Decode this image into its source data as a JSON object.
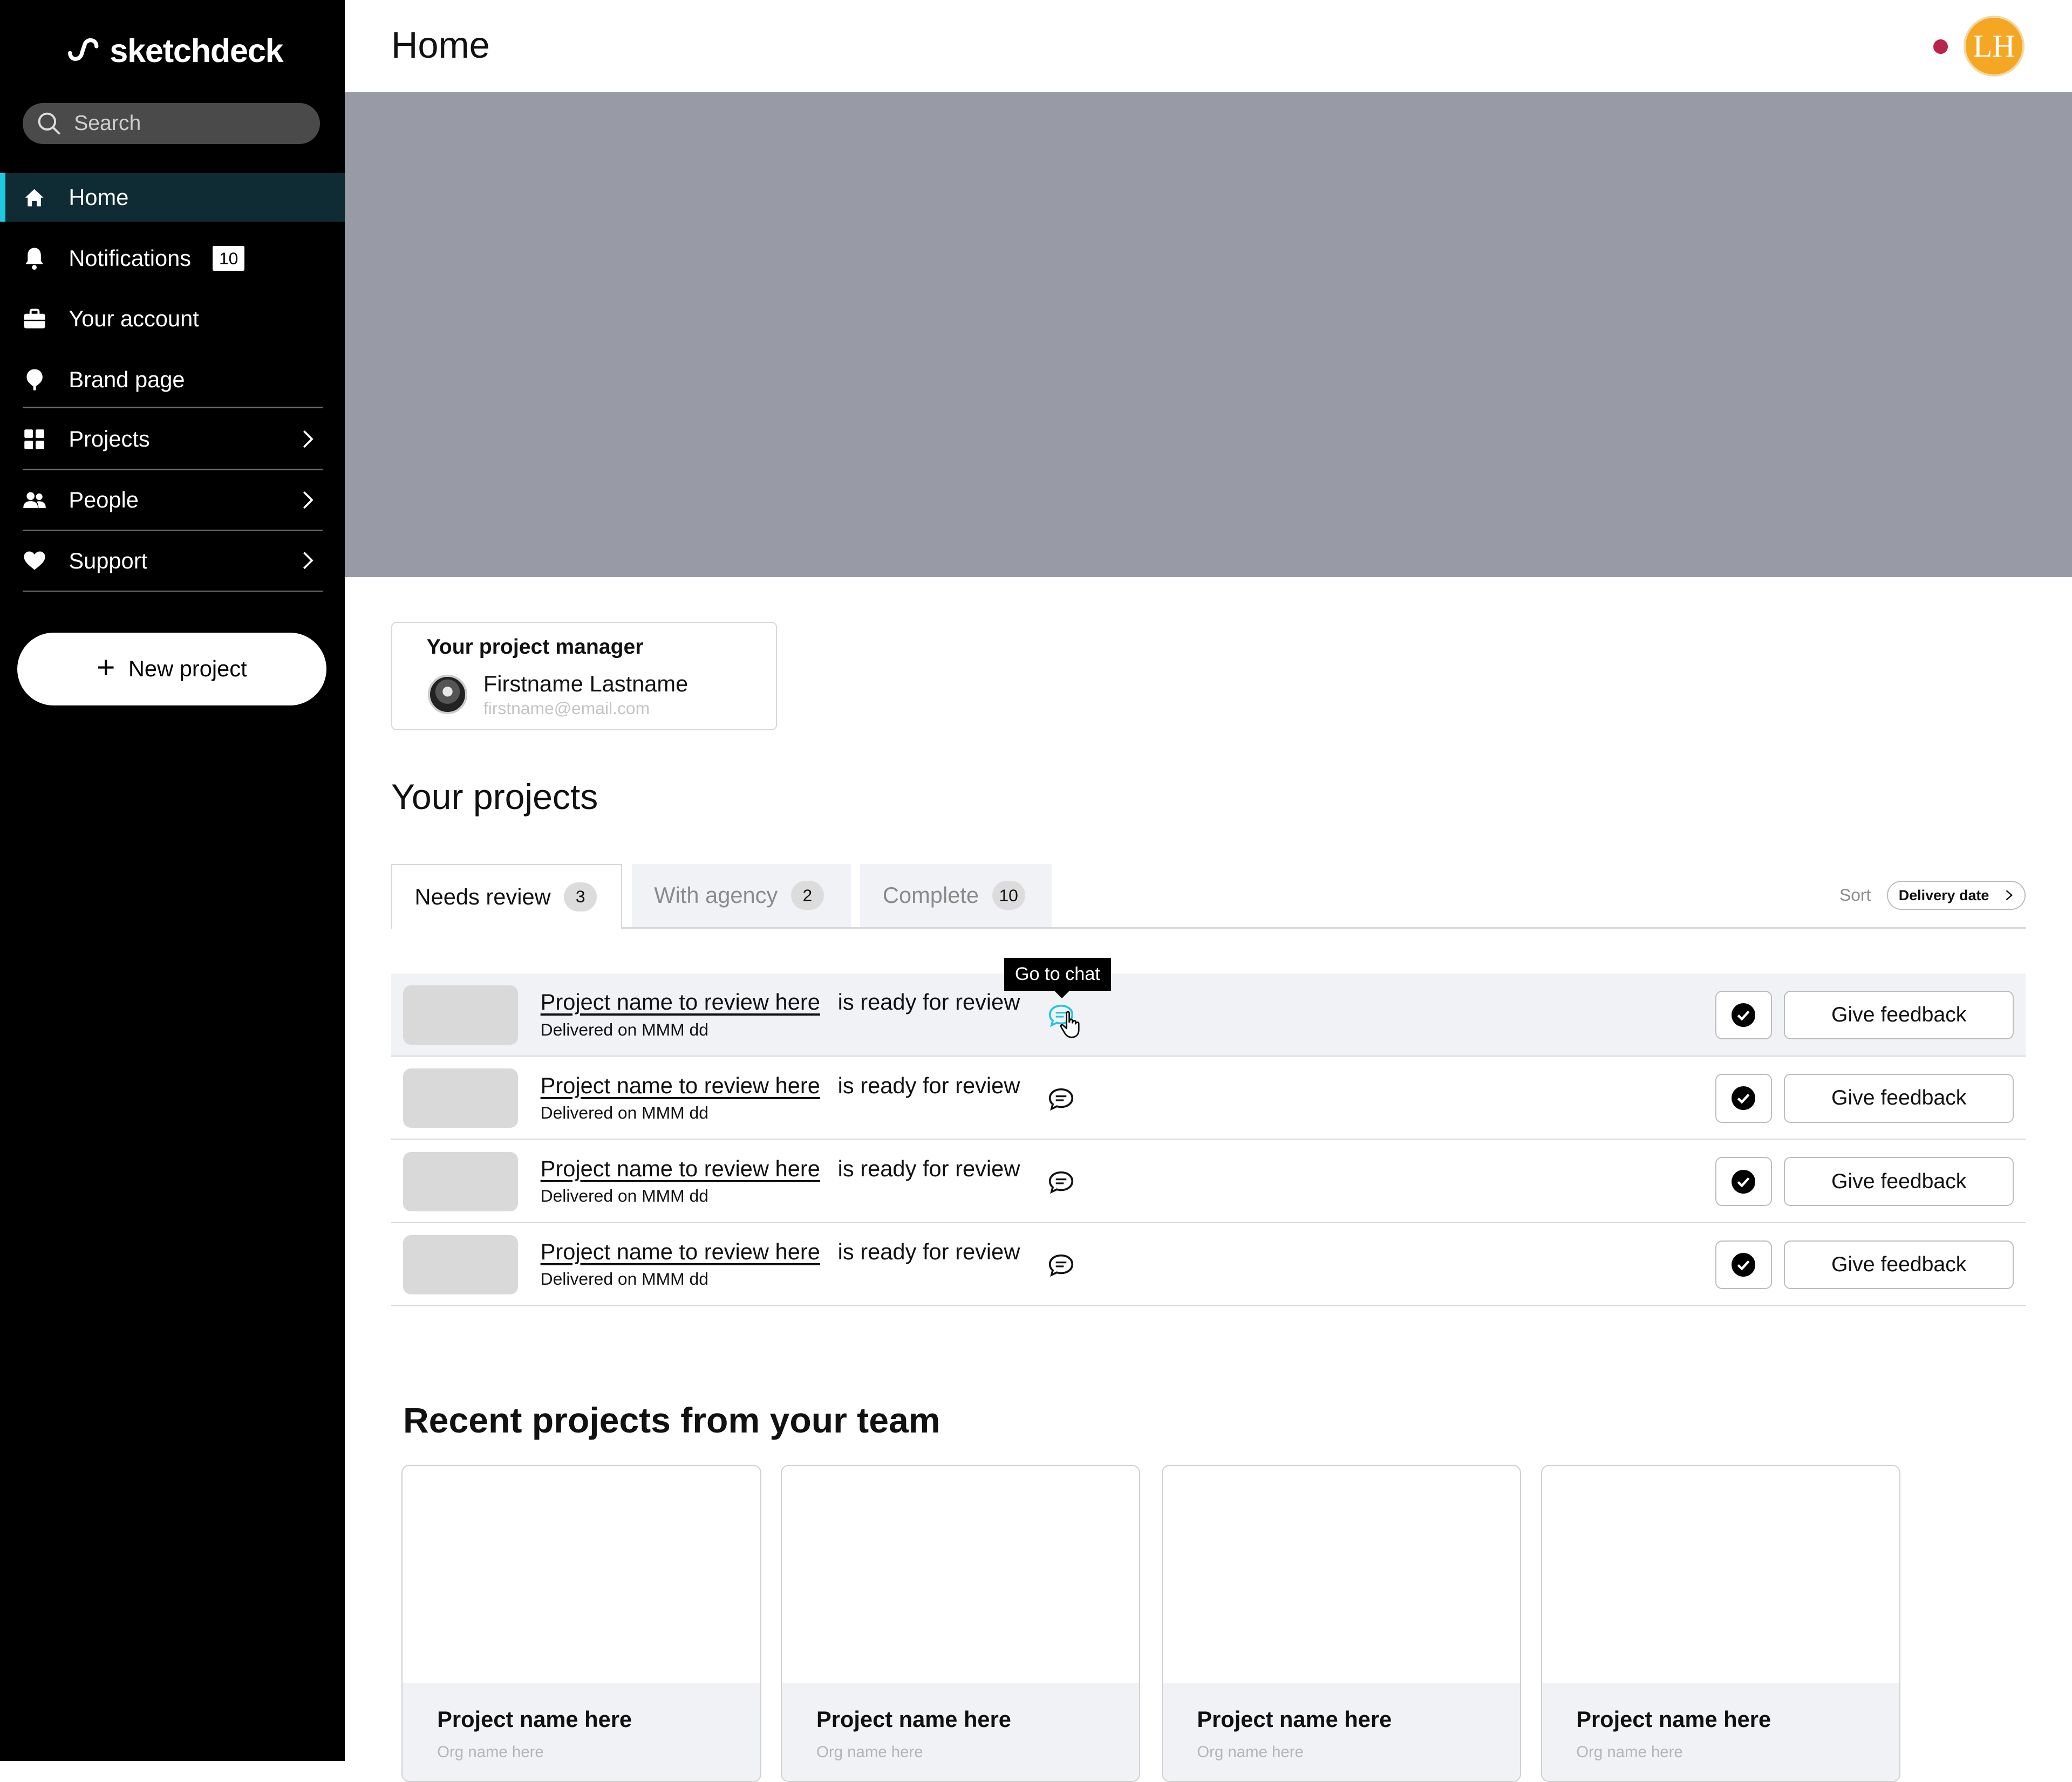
{
  "app": {
    "brand": "sketchdeck"
  },
  "search": {
    "placeholder": "Search"
  },
  "sidebar": {
    "items": [
      {
        "label": "Home",
        "icon": "home-icon",
        "active": true
      },
      {
        "label": "Notifications",
        "icon": "bell-icon",
        "badge": "10"
      },
      {
        "label": "Your account",
        "icon": "briefcase-icon"
      },
      {
        "label": "Brand page",
        "icon": "pin-icon"
      },
      {
        "label": "Projects",
        "icon": "grid-icon",
        "expandable": true
      },
      {
        "label": "People",
        "icon": "people-icon",
        "expandable": true
      },
      {
        "label": "Support",
        "icon": "heart-icon",
        "expandable": true
      }
    ],
    "new_project_label": "New project"
  },
  "header": {
    "title": "Home",
    "avatar_initials": "LH",
    "status_color": "#b8244a",
    "avatar_color": "#f5a623"
  },
  "project_manager": {
    "title": "Your project manager",
    "name": "Firstname Lastname",
    "email": "firstname@email.com"
  },
  "projects": {
    "heading": "Your projects",
    "tabs": [
      {
        "label": "Needs review",
        "count": "3",
        "active": true
      },
      {
        "label": "With agency",
        "count": "2"
      },
      {
        "label": "Complete",
        "count": "10"
      }
    ],
    "sort": {
      "label": "Sort",
      "value": "Delivery date"
    },
    "tooltip": "Go to chat",
    "rows": [
      {
        "name": "Project name to review here",
        "status": "is ready for review",
        "delivered": "Delivered on MMM dd",
        "feedback_label": "Give feedback"
      },
      {
        "name": "Project name to review here",
        "status": "is ready for review",
        "delivered": "Delivered on MMM dd",
        "feedback_label": "Give feedback"
      },
      {
        "name": "Project name to review here",
        "status": "is ready for review",
        "delivered": "Delivered on MMM dd",
        "feedback_label": "Give feedback"
      },
      {
        "name": "Project name to review here",
        "status": "is ready for review",
        "delivered": "Delivered on MMM dd",
        "feedback_label": "Give feedback"
      }
    ]
  },
  "recent": {
    "heading": "Recent projects from your team",
    "cards": [
      {
        "title": "Project name here",
        "org": "Org name here"
      },
      {
        "title": "Project name here",
        "org": "Org name here"
      },
      {
        "title": "Project name here",
        "org": "Org name here"
      },
      {
        "title": "Project name here",
        "org": "Org name here"
      }
    ]
  },
  "colors": {
    "accent": "#1ec8e0",
    "hero": "#989aa5",
    "sidebar": "#000000"
  }
}
